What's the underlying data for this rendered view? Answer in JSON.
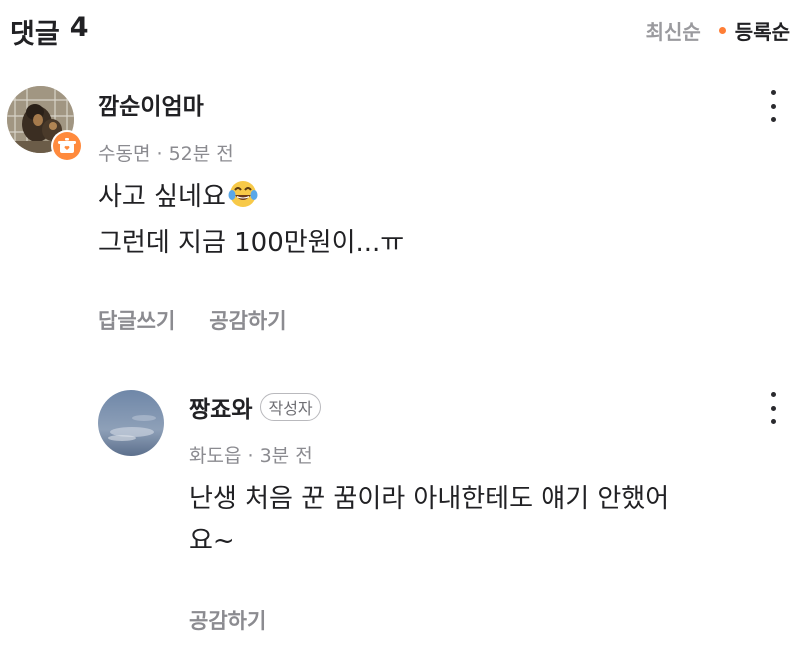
{
  "header": {
    "title": "댓글",
    "count": "4",
    "sort_latest": "최신순",
    "sort_registered": "등록순",
    "accent_color": "#ff7e36"
  },
  "comments": [
    {
      "nickname": "깜순이엄마",
      "location": "수동면",
      "time": "52분 전",
      "lines": [
        "사고 싶네요",
        "그런데 지금 100만원이...ㅠ"
      ],
      "emoji": "face-with-tears-of-joy",
      "badge_icon": "pot-badge-icon",
      "actions": [
        "답글쓰기",
        "공감하기"
      ]
    }
  ],
  "replies": [
    {
      "nickname": "짱죠와",
      "author_tag": "작성자",
      "location": "화도읍",
      "time": "3분 전",
      "lines": [
        "난생 처음 꾼 꿈이라 아내한테도 얘기 안했어",
        "요~"
      ],
      "actions": [
        "공감하기"
      ]
    }
  ]
}
